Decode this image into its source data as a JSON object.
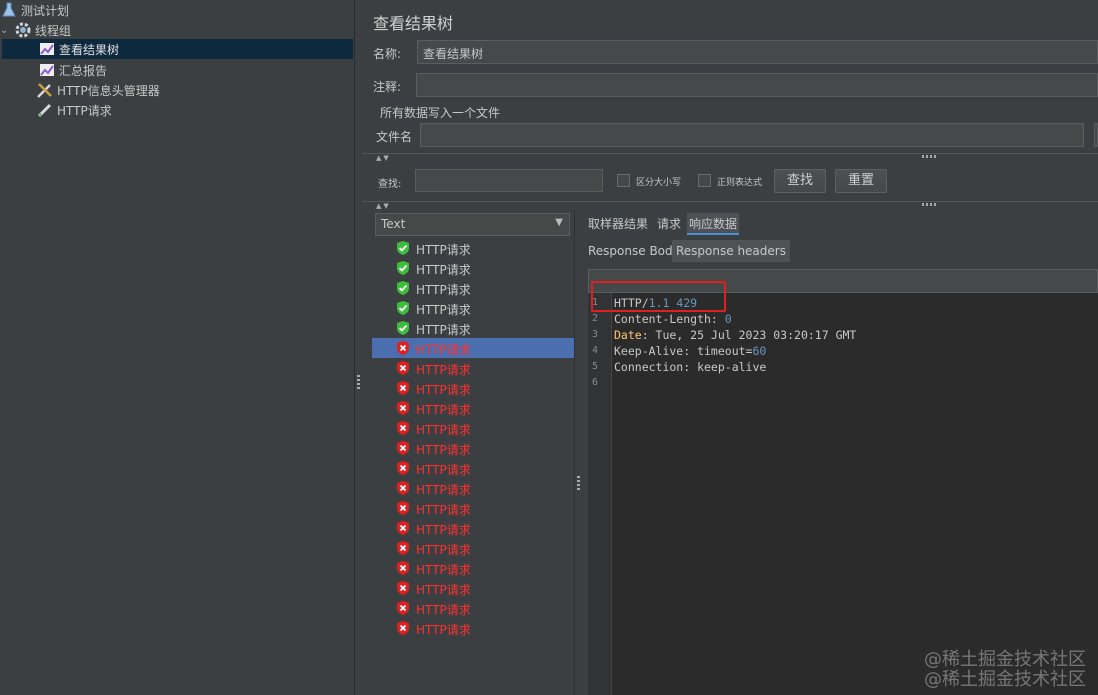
{
  "tree": {
    "items": [
      {
        "label": "测试计划",
        "icon": "flask-icon"
      },
      {
        "label": "线程组",
        "icon": "gear-icon"
      },
      {
        "label": "查看结果树",
        "icon": "chart-listener-icon"
      },
      {
        "label": "汇总报告",
        "icon": "chart-listener-icon"
      },
      {
        "label": "HTTP信息头管理器",
        "icon": "wrench-icon"
      },
      {
        "label": "HTTP请求",
        "icon": "pipette-icon"
      }
    ]
  },
  "panel": {
    "title": "查看结果树",
    "name_label": "名称:",
    "name_value": "查看结果树",
    "comment_label": "注释:",
    "comment_value": "",
    "write_all_label": "所有数据写入一个文件",
    "filename_label": "文件名",
    "filename_value": "",
    "search_label": "查找:",
    "search_value": "",
    "case_sensitive_label": "区分大小写",
    "regex_label": "正则表达式",
    "find_button": "查找",
    "reset_button": "重置"
  },
  "renderer": {
    "selected": "Text"
  },
  "results": [
    {
      "label": "HTTP请求",
      "status": "ok"
    },
    {
      "label": "HTTP请求",
      "status": "ok"
    },
    {
      "label": "HTTP请求",
      "status": "ok"
    },
    {
      "label": "HTTP请求",
      "status": "ok"
    },
    {
      "label": "HTTP请求",
      "status": "ok"
    },
    {
      "label": "HTTP请求",
      "status": "error",
      "selected": true
    },
    {
      "label": "HTTP请求",
      "status": "error"
    },
    {
      "label": "HTTP请求",
      "status": "error"
    },
    {
      "label": "HTTP请求",
      "status": "error"
    },
    {
      "label": "HTTP请求",
      "status": "error"
    },
    {
      "label": "HTTP请求",
      "status": "error"
    },
    {
      "label": "HTTP请求",
      "status": "error"
    },
    {
      "label": "HTTP请求",
      "status": "error"
    },
    {
      "label": "HTTP请求",
      "status": "error"
    },
    {
      "label": "HTTP请求",
      "status": "error"
    },
    {
      "label": "HTTP请求",
      "status": "error"
    },
    {
      "label": "HTTP请求",
      "status": "error"
    },
    {
      "label": "HTTP请求",
      "status": "error"
    },
    {
      "label": "HTTP请求",
      "status": "error"
    },
    {
      "label": "HTTP请求",
      "status": "error"
    }
  ],
  "result_tabs": {
    "sampler_result": "取样器结果",
    "request": "请求",
    "response_data": "响应数据",
    "active": "响应数据"
  },
  "response_subtabs": {
    "body": "Response Body",
    "headers": "Response headers",
    "active": "Response headers"
  },
  "response_headers": {
    "line_numbers": [
      "1",
      "2",
      "3",
      "4",
      "5",
      "6"
    ],
    "lines": [
      {
        "key": "HTTP/",
        "value": "1.1 429"
      },
      {
        "key": "Content-Length: ",
        "value": "0"
      },
      {
        "key": "Date",
        "value": ": Tue, 25 Jul 2023 03:20:17 GMT"
      },
      {
        "key": "Keep-Alive: timeout=",
        "value": "60"
      },
      {
        "key": "Connection: keep-alive",
        "value": ""
      },
      {
        "key": "",
        "value": ""
      }
    ]
  },
  "watermark": [
    "@稀土掘金技术社区",
    "@稀土掘金技术社区"
  ],
  "colors": {
    "background": "#3c3f41",
    "editor_bg": "#2b2b2b",
    "selection": "#4b6eaf",
    "error_text": "#ff3030",
    "success_icon": "#3bbf3b",
    "error_icon": "#e02020",
    "highlight_box": "#e02020"
  }
}
